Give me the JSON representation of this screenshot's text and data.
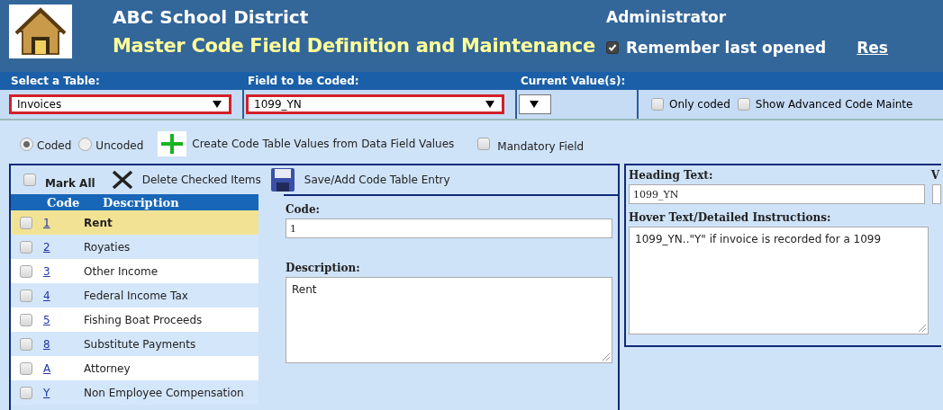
{
  "header": {
    "district": "ABC School District",
    "title": "Master Code Field Definition and Maintenance",
    "role": "Administrator",
    "remember": {
      "label": "Remember last opened",
      "checked": true
    },
    "link": "Res"
  },
  "selectors": [
    {
      "kind": "select",
      "label": "Select a Table:",
      "value": "Invoices",
      "highlighted": true
    },
    {
      "kind": "select",
      "label": "Field to be Coded:",
      "value": "1099_YN",
      "highlighted": true
    },
    {
      "kind": "small",
      "label": "Current Value(s):",
      "highlighted": false
    }
  ],
  "filters": [
    {
      "label": "Only coded",
      "checked": false
    },
    {
      "label": "Show Advanced Code Mainte",
      "checked": false
    }
  ],
  "modes": [
    {
      "label": "Coded",
      "selected": true
    },
    {
      "label": "Uncoded",
      "selected": false
    }
  ],
  "create_button": "Create Code Table Values from Data Field Values",
  "mandatory": {
    "label": "Mandatory Field",
    "checked": false
  },
  "toolbar": {
    "mark_all": {
      "label": "Mark All",
      "checked": false
    },
    "delete": "Delete Checked Items",
    "save": "Save/Add Code Table Entry"
  },
  "table": {
    "columns": [
      "Code",
      "Description"
    ],
    "rows": [
      {
        "code": "1",
        "description": "Rent",
        "selected": true,
        "checked": false
      },
      {
        "code": "2",
        "description": "Royaties",
        "selected": false,
        "checked": false
      },
      {
        "code": "3",
        "description": "Other Income",
        "selected": false,
        "checked": false
      },
      {
        "code": "4",
        "description": "Federal Income Tax",
        "selected": false,
        "checked": false
      },
      {
        "code": "5",
        "description": "Fishing Boat Proceeds",
        "selected": false,
        "checked": false
      },
      {
        "code": "8",
        "description": "Substitute Payments",
        "selected": false,
        "checked": false
      },
      {
        "code": "A",
        "description": "Attorney",
        "selected": false,
        "checked": false
      },
      {
        "code": "Y",
        "description": "Non Employee Compensation",
        "selected": false,
        "checked": false
      }
    ]
  },
  "entry": {
    "code_label": "Code:",
    "code": "1",
    "description_label": "Description:",
    "description": "Rent"
  },
  "details": {
    "heading_label": "Heading Text:",
    "heading": "1099_YN",
    "hover_label": "Hover Text/Detailed Instructions:",
    "hover": "1099_YN..\"Y\" if invoice is recorded for a 1099",
    "cut_label": "V"
  }
}
